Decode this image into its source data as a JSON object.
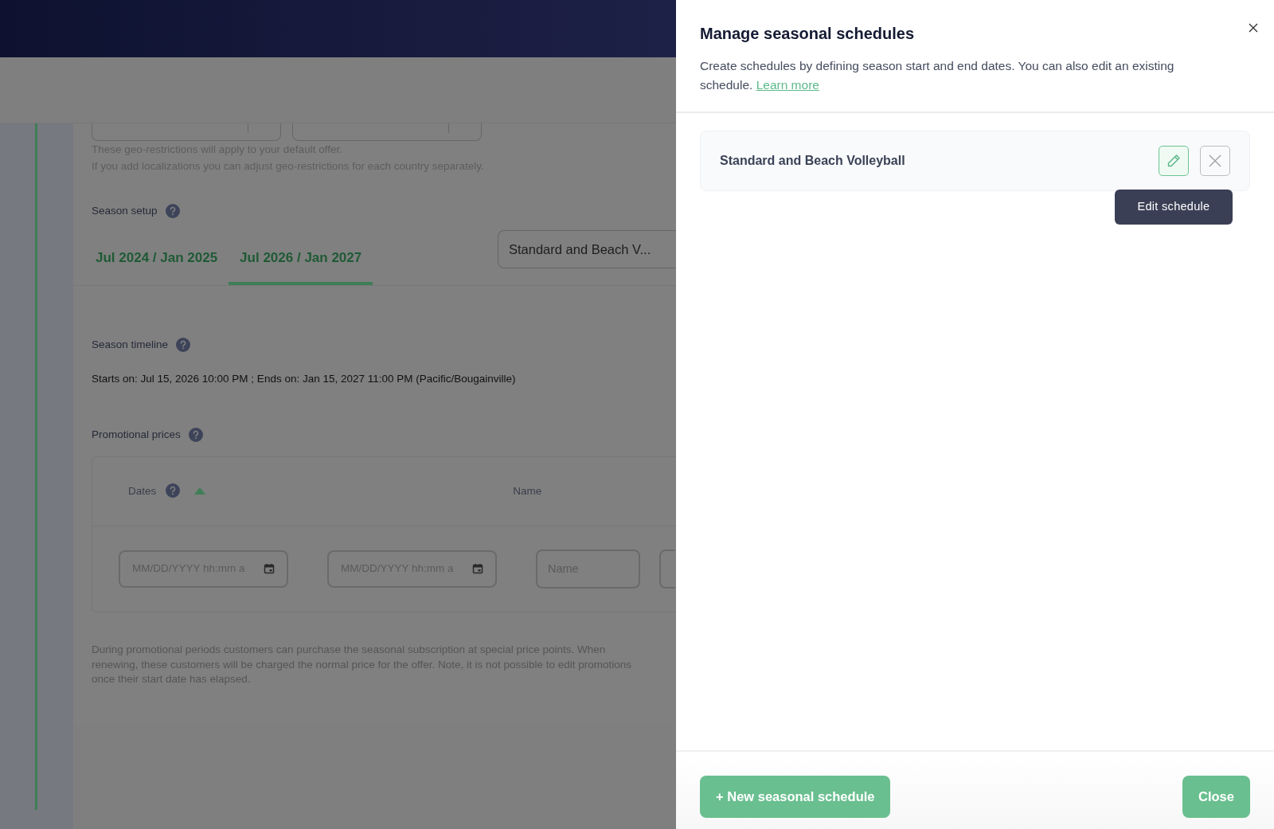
{
  "background": {
    "geo_notes": [
      "These geo-restrictions will apply to your default offer.",
      "If you add localizations you can adjust geo-restrictions for each country separately."
    ],
    "season_setup": {
      "label": "Season setup",
      "tabs": [
        {
          "label": "Jul 2024 / Jan 2025",
          "selected": false
        },
        {
          "label": "Jul 2026 / Jan 2027",
          "selected": true
        }
      ],
      "schedule_select": "Standard and Beach V..."
    },
    "season_timeline": {
      "label": "Season timeline",
      "text": "Starts on: Jul 15, 2026 10:00 PM ; Ends on: Jan 15, 2027 11:00 PM (Pacific/Bougainville)"
    },
    "promotional_prices": {
      "label": "Promotional prices",
      "columns": [
        "Dates",
        "Name"
      ],
      "inputs": [
        {
          "kind": "date",
          "placeholder": "MM/DD/YYYY hh:mm a"
        },
        {
          "kind": "date",
          "placeholder": "MM/DD/YYYY hh:mm a"
        },
        {
          "kind": "text",
          "placeholder": "Name"
        }
      ],
      "note": "During promotional periods customers can purchase the seasonal subscription at special price points. When renewing, these customers will be charged the normal price for the offer. Note, it is not possible to edit promotions once their start date has elapsed."
    }
  },
  "panel": {
    "title": "Manage seasonal schedules",
    "description": "Create schedules by defining season start and end dates. You can also edit an existing schedule.",
    "link": "Learn more",
    "schedules": [
      {
        "name": "Standard and Beach Volleyball"
      }
    ],
    "tooltip": "Edit schedule",
    "buttons": [
      "+ New seasonal schedule",
      "Close"
    ]
  }
}
